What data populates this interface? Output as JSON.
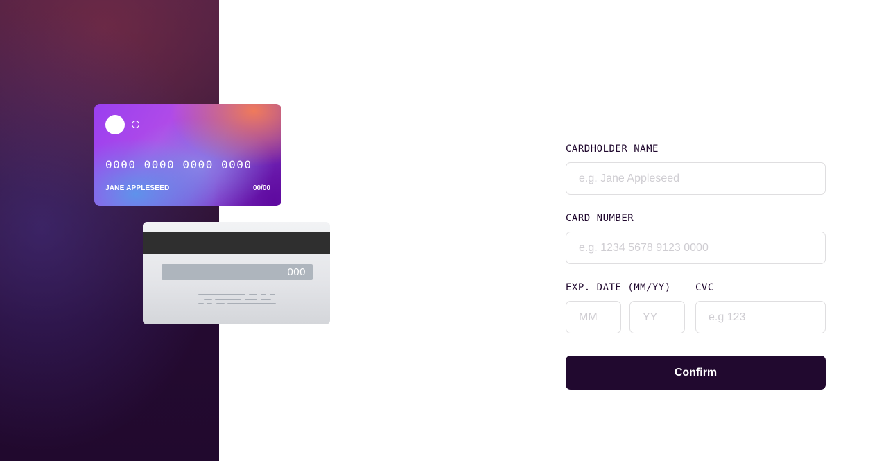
{
  "card_front": {
    "number": "0000 0000 0000 0000",
    "holder": "JANE APPLESEED",
    "expiry": "00/00"
  },
  "card_back": {
    "cvc": "000"
  },
  "form": {
    "cardholder": {
      "label": "CARDHOLDER NAME",
      "placeholder": "e.g. Jane Appleseed",
      "value": ""
    },
    "card_number": {
      "label": "CARD NUMBER",
      "placeholder": "e.g. 1234 5678 9123 0000",
      "value": ""
    },
    "expiry": {
      "label": "EXP. DATE (MM/YY)",
      "month_placeholder": "MM",
      "year_placeholder": "YY"
    },
    "cvc": {
      "label": "CVC",
      "placeholder": "e.g 123",
      "value": ""
    },
    "confirm_label": "Confirm"
  },
  "colors": {
    "primary_dark": "#21092f",
    "input_border": "#dfdee0",
    "placeholder": "#cfcdd2"
  }
}
